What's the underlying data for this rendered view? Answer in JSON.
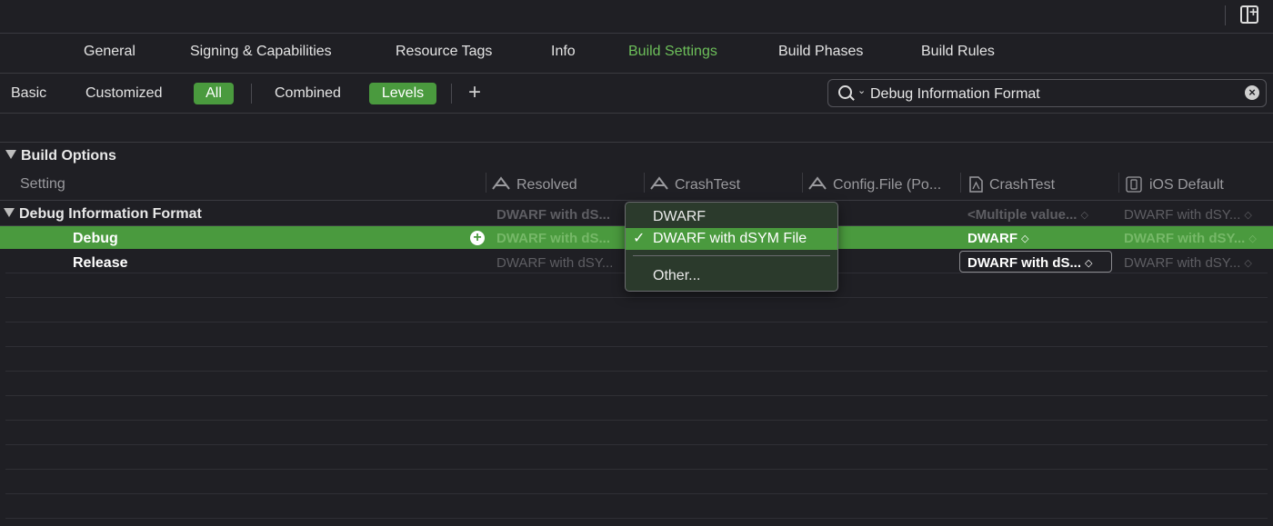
{
  "tabs": [
    {
      "label": "General",
      "active": false
    },
    {
      "label": "Signing & Capabilities",
      "active": false
    },
    {
      "label": "Resource Tags",
      "active": false
    },
    {
      "label": "Info",
      "active": false
    },
    {
      "label": "Build Settings",
      "active": true
    },
    {
      "label": "Build Phases",
      "active": false
    },
    {
      "label": "Build Rules",
      "active": false
    }
  ],
  "filters": {
    "basic": "Basic",
    "customized": "Customized",
    "all": "All",
    "combined": "Combined",
    "levels": "Levels",
    "add_icon": "plus-icon"
  },
  "search": {
    "value": "Debug Information Format",
    "icon": "search-icon"
  },
  "section": {
    "title": "Build Options"
  },
  "columns": {
    "setting": "Setting",
    "resolved": "Resolved",
    "target": "CrashTest",
    "config_file": "Config.File (Po...",
    "project": "CrashTest",
    "ios_default": "iOS Default"
  },
  "setting": {
    "title": "Debug Information Format",
    "resolved": "DWARF with dS...",
    "project": "<Multiple value...",
    "ios_default": "DWARF with dSY..."
  },
  "rows": [
    {
      "label": "Debug",
      "resolved": "DWARF with dS...",
      "project": "DWARF",
      "ios_default": "DWARF with dSY..."
    },
    {
      "label": "Release",
      "resolved": "DWARF with dSY...",
      "project": "DWARF with dS...",
      "ios_default": "DWARF with dSY..."
    }
  ],
  "menu": {
    "items": [
      "DWARF",
      "DWARF with dSYM File"
    ],
    "selected_index": 1,
    "check": "✓",
    "other": "Other..."
  },
  "colors": {
    "accent": "#4a9a3e",
    "active_tab": "#6dbf5a",
    "background": "#1f1f24"
  }
}
